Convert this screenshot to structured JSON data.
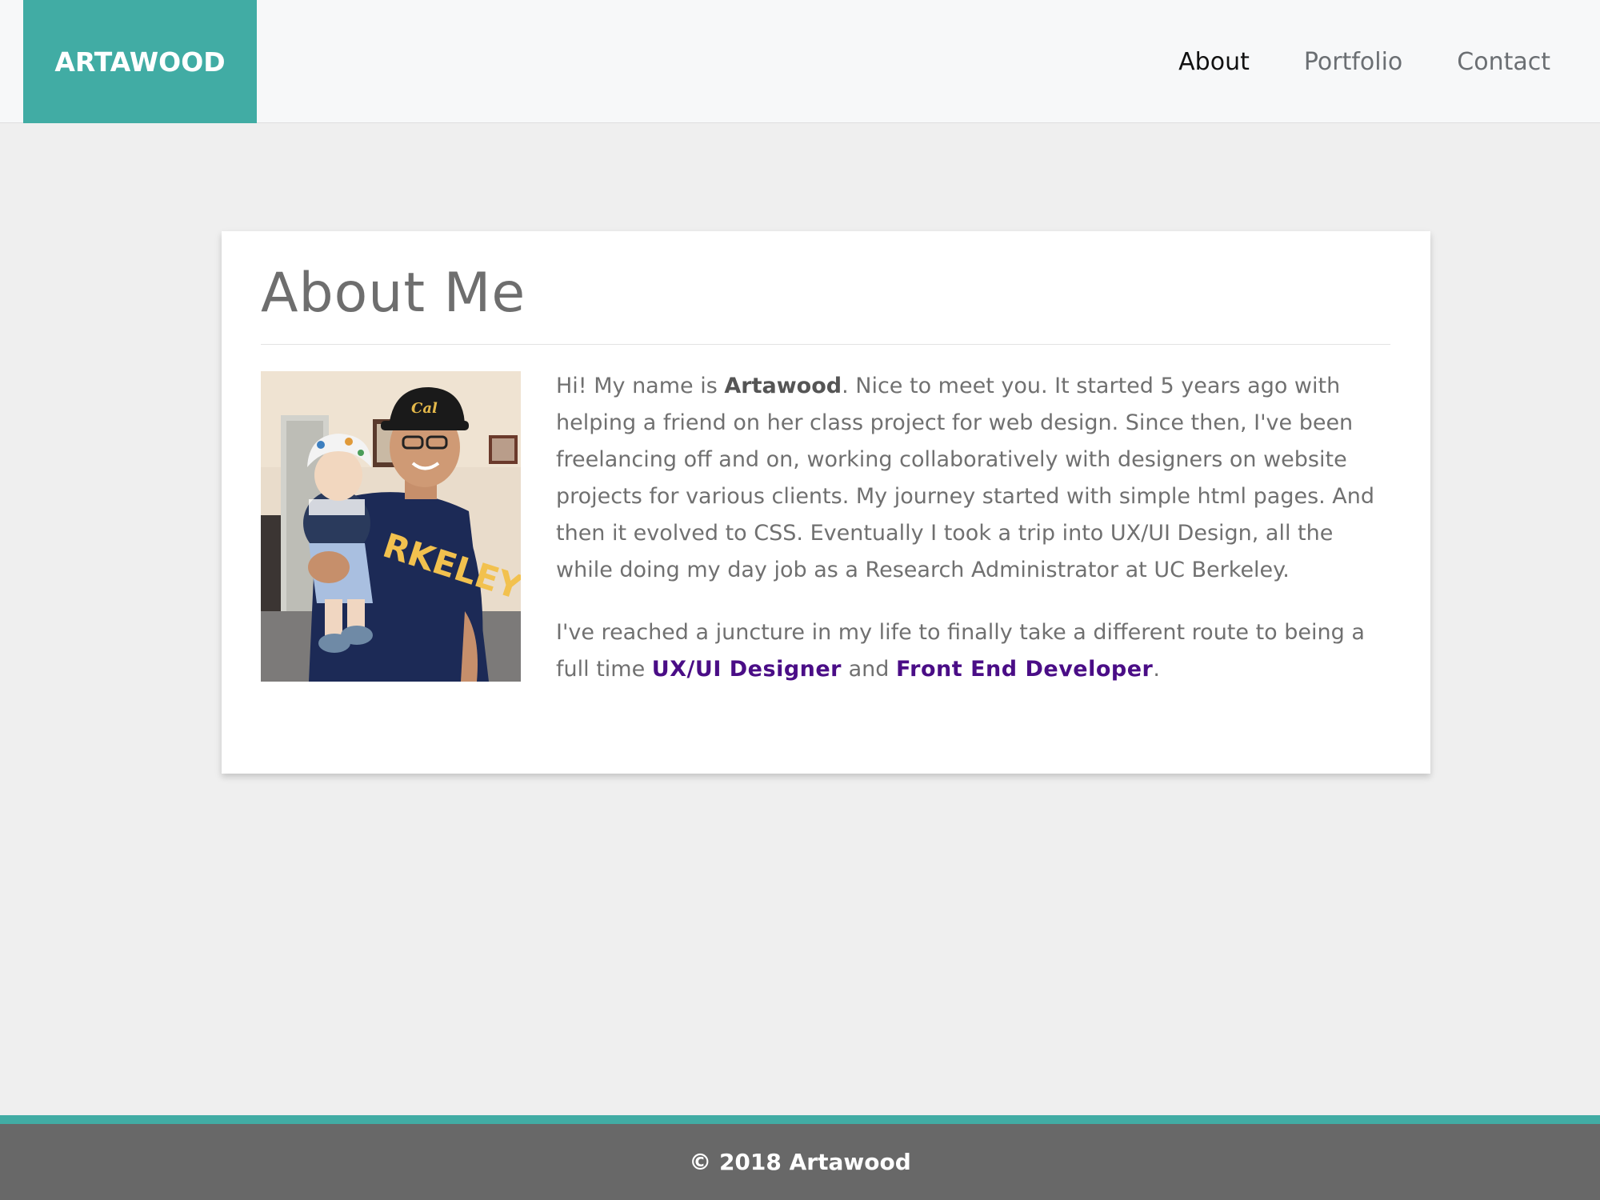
{
  "header": {
    "brand": "ARTAWOOD",
    "nav": [
      {
        "label": "About",
        "active": true
      },
      {
        "label": "Portfolio",
        "active": false
      },
      {
        "label": "Contact",
        "active": false
      }
    ]
  },
  "about": {
    "title": "About Me",
    "photo_subject": "man holding baby",
    "shirt_text": "RKELEY",
    "cap_text": "Cal",
    "para1_a": "Hi! My name is ",
    "para1_name": "Artawood",
    "para1_b": ". Nice to meet you. It started 5 years ago with helping a friend on her class project for web design. Since then, I've been freelancing off and on, working collaboratively with designers on website projects for various clients. My journey started with simple html pages. And then it evolved to CSS. Eventually I took a trip into UX/UI Design, all the while doing my day job as a Research Administrator at UC Berkeley.",
    "para2_a": "I've reached a juncture in my life to finally take a different route to being a full time ",
    "role1": "UX/UI Designer",
    "para2_and": " and ",
    "role2": "Front End Developer",
    "para2_end": "."
  },
  "footer": {
    "text": "© 2018 Artawood"
  },
  "colors": {
    "accent": "#41aca4",
    "link": "#4a0d86",
    "footer_bg": "#686868"
  }
}
